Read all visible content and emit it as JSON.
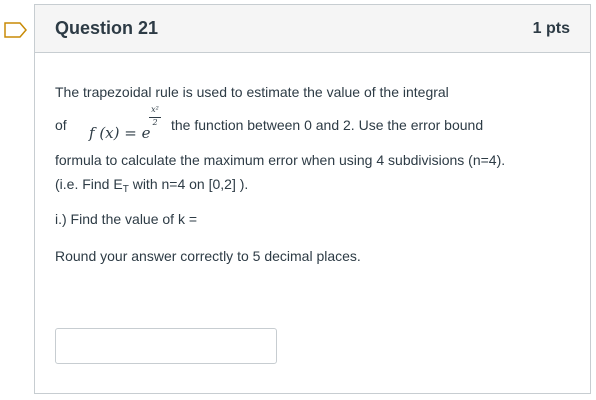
{
  "question": {
    "title": "Question 21",
    "points": "1 pts"
  },
  "body": {
    "line1": "The trapezoidal rule is used to estimate the value of the integral",
    "line2_prefix": "of",
    "formula_fx": "f (x) = e",
    "exponent_numerator": "x²",
    "exponent_denominator": "2",
    "line2_suffix": "the function between 0 and 2.  Use the error bound",
    "line3": "formula to calculate the maximum error when using 4 subdivisions (n=4).",
    "line4_prefix": " (i.e. Find E",
    "line4_subscript": "T",
    "line4_suffix": " with n=4 on [0,2] ).",
    "line5": "i.) Find the value of k =",
    "line6": "Round your answer correctly to 5 decimal places."
  },
  "answer": {
    "value": "",
    "placeholder": ""
  }
}
